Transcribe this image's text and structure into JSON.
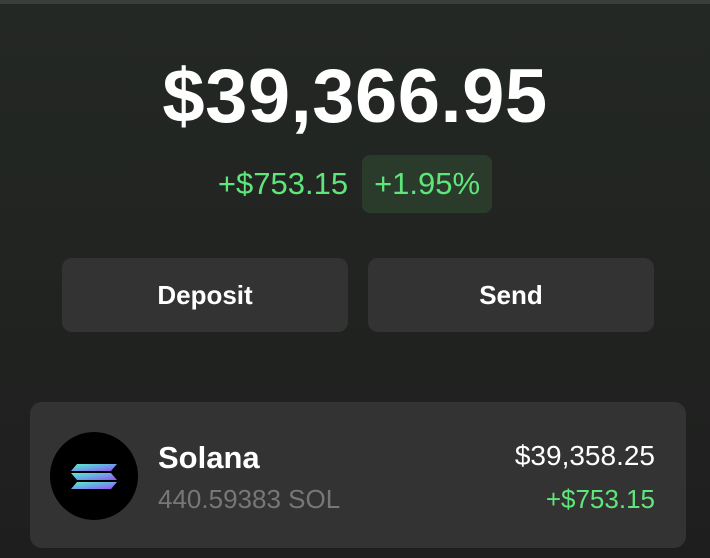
{
  "portfolio": {
    "balance": "$39,366.95",
    "change_abs": "+$753.15",
    "change_pct": "+1.95%"
  },
  "actions": {
    "deposit_label": "Deposit",
    "send_label": "Send"
  },
  "tokens": [
    {
      "name": "Solana",
      "amount": "440.59383 SOL",
      "value": "$39,358.25",
      "change": "+$753.15",
      "icon": "solana-logo-icon"
    }
  ],
  "colors": {
    "background": "#222522",
    "card": "#333333",
    "positive": "#5ee67a",
    "positive_badge_bg": "#2a3b2c",
    "muted_text": "#777777"
  }
}
